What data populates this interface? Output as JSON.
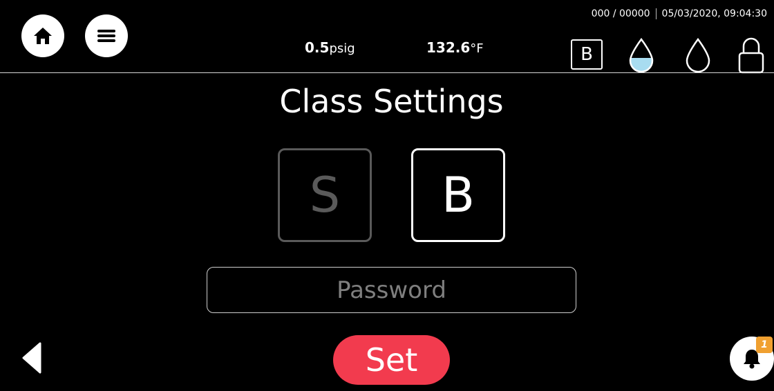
{
  "header": {
    "status": {
      "cycle_counter": "000 / 00000",
      "datetime": "05/03/2020, 09:04:30"
    },
    "pressure": {
      "value": "0.5",
      "unit": "psig"
    },
    "temperature": {
      "value": "132.6",
      "unit": "°F"
    },
    "class_indicator": "B",
    "icons": {
      "home": "home-icon",
      "menu": "menu-icon",
      "water_level_filled": "water-drop-filled-icon",
      "water_level_empty": "water-drop-empty-icon",
      "lock": "lock-icon"
    }
  },
  "main": {
    "title": "Class Settings",
    "class_options": [
      {
        "label": "S",
        "selected": false
      },
      {
        "label": "B",
        "selected": true
      }
    ],
    "password": {
      "placeholder": "Password",
      "value": ""
    },
    "set_label": "Set"
  },
  "footer": {
    "back_icon": "back-arrow-icon",
    "notification": {
      "icon": "bell-icon",
      "count": "1"
    }
  },
  "colors": {
    "background": "#000000",
    "set_button": "#f23b4e",
    "badge": "#f0a030",
    "water_fill": "#a8dcf0",
    "disabled": "#5a5a5a"
  }
}
